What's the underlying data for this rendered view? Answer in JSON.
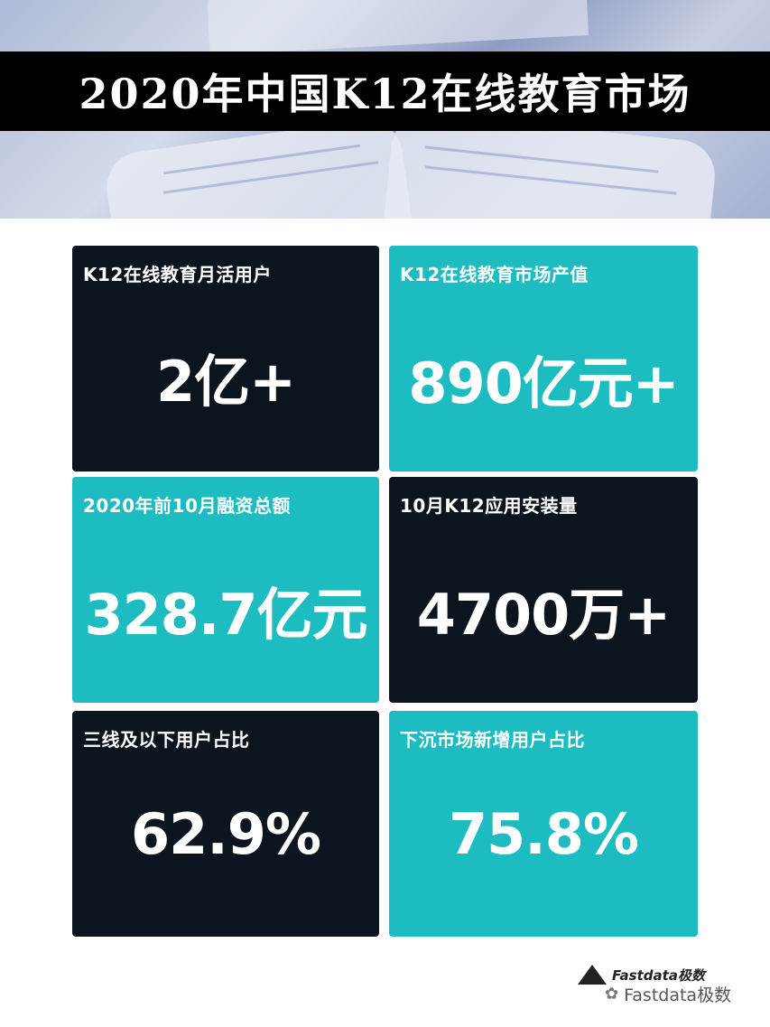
{
  "title": "2020年中国K12在线教育市场",
  "cards": [
    {
      "label": "K12在线教育月活用户",
      "value": "2亿+"
    },
    {
      "label": "K12在线教育市场产值",
      "value": "890亿元+"
    },
    {
      "label": "2020年前10月融资总额",
      "value": "328.7亿元"
    },
    {
      "label": "10月K12应用安装量",
      "value": "4700万+"
    },
    {
      "label": "三线及以下用户占比",
      "value": "62.9%"
    },
    {
      "label": "下沉市场新增用户占比",
      "value": "75.8%"
    }
  ],
  "logo": {
    "text": "Fastdata极数",
    "icon": "mountain-icon"
  },
  "watermark": {
    "text": "Fastdata极数",
    "icon": "wechat-icon"
  },
  "colors": {
    "dark": "#0c141e",
    "teal": "#1cbcc0"
  }
}
